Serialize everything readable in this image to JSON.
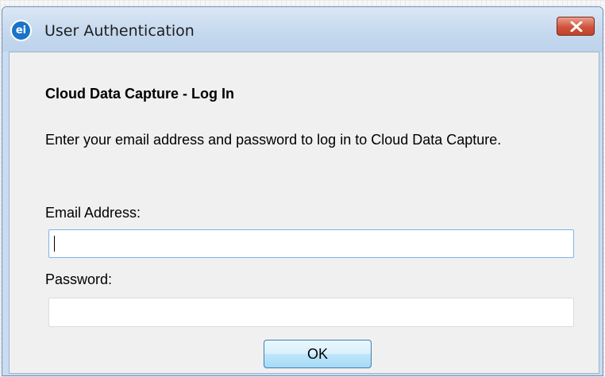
{
  "window": {
    "title": "User Authentication",
    "app_icon_text": "ei",
    "close_icon": "close-x-icon"
  },
  "dialog": {
    "heading": "Cloud Data Capture - Log In",
    "description": "Enter your email address and password to log in to Cloud Data Capture.",
    "email": {
      "label": "Email Address:",
      "value": "",
      "placeholder": ""
    },
    "password": {
      "label": "Password:",
      "value": "",
      "placeholder": ""
    },
    "ok_label": "OK"
  },
  "colors": {
    "close_button": "#c9432b",
    "focus_border": "#7eb4ea",
    "ok_button": "#bee6fd"
  }
}
